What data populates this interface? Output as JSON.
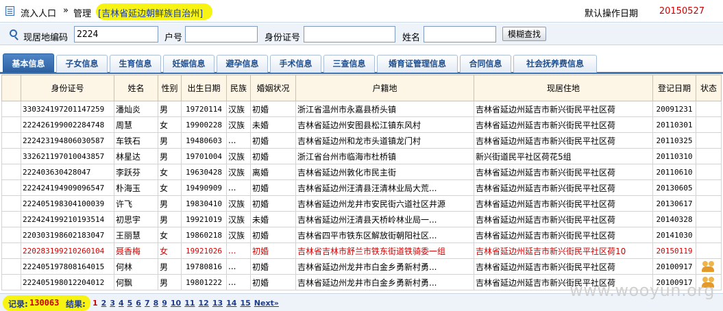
{
  "header": {
    "crumb_1": "流入人口",
    "separator": "»",
    "crumb_2": "管理",
    "region": "[吉林省延边朝鲜族自治州]",
    "default_date_label": "默认操作日期",
    "default_date": "20150527"
  },
  "search": {
    "residence_code_label": "现居地编码",
    "residence_code_value": "2224",
    "household_label": "户号",
    "household_value": "",
    "id_label": "身份证号",
    "id_value": "",
    "name_label": "姓名",
    "name_value": "",
    "fuzzy_button": "模糊查找"
  },
  "tabs": [
    {
      "label": "基本信息",
      "active": true
    },
    {
      "label": "子女信息"
    },
    {
      "label": "生育信息"
    },
    {
      "label": "妊娠信息"
    },
    {
      "label": "避孕信息"
    },
    {
      "label": "手术信息"
    },
    {
      "label": "三查信息"
    },
    {
      "label": "婚育证管理信息"
    },
    {
      "label": "合同信息"
    },
    {
      "label": "社会抚养费信息"
    }
  ],
  "table": {
    "headers": [
      "",
      "身份证号",
      "姓名",
      "性别",
      "出生日期",
      "民族",
      "婚姻状况",
      "户籍地",
      "现居住地",
      "登记日期",
      "状态"
    ],
    "rows": [
      [
        "330324197201147259",
        "潘灿炎",
        "男",
        "19720114",
        "汉族",
        "初婚",
        "浙江省温州市永嘉县桥头镇",
        "吉林省延边州延吉市新兴街民平社区荷",
        "20091231",
        ""
      ],
      [
        "222426199002284748",
        "周慧",
        "女",
        "19900228",
        "汉族",
        "未婚",
        "吉林省延边州安图县松江镇东风村",
        "吉林省延边州延吉市新兴街民平社区荷",
        "20110301",
        ""
      ],
      [
        "222423194806030587",
        "车铁石",
        "男",
        "19480603",
        "...",
        "初婚",
        "吉林省延边州和龙市头道镇龙门村",
        "吉林省延边州延吉市新兴街民平社区荷",
        "20110325",
        ""
      ],
      [
        "332621197010043857",
        "林星达",
        "男",
        "19701004",
        "汉族",
        "初婚",
        "浙江省台州市临海市杜桥镇",
        "新兴街道民平社区荷花5组",
        "20110310",
        ""
      ],
      [
        "222403630428047",
        "李跃芬",
        "女",
        "19630428",
        "汉族",
        "离婚",
        "吉林省延边州敦化市民主街",
        "吉林省延边州延吉市新兴街民平社区荷",
        "20110610",
        ""
      ],
      [
        "222424194909096547",
        "朴海玉",
        "女",
        "19490909",
        "...",
        "初婚",
        "吉林省延边州汪清县汪清林业局大荒...",
        "吉林省延边州延吉市新兴街民平社区荷",
        "20130605",
        ""
      ],
      [
        "222405198304100039",
        "许飞",
        "男",
        "19830410",
        "汉族",
        "初婚",
        "吉林省延边州龙井市安民街六道社区井源",
        "吉林省延边州延吉市新兴街民平社区荷",
        "20130617",
        ""
      ],
      [
        "222424199210193514",
        "初思宇",
        "男",
        "19921019",
        "汉族",
        "未婚",
        "吉林省延边州汪清县天桥岭林业局一...",
        "吉林省延边州延吉市新兴街民平社区荷",
        "20140328",
        ""
      ],
      [
        "220303198602183047",
        "王丽慧",
        "女",
        "19860218",
        "汉族",
        "初婚",
        "吉林省四平市铁东区解放街朝阳社区...",
        "吉林省延边州延吉市新兴街民平社区荷",
        "20141030",
        ""
      ],
      [
        "220283199210260104",
        "聂香梅",
        "女",
        "19921026",
        "...",
        "初婚",
        "吉林省吉林市舒兰市铁东街道铁骑委一组",
        "吉林省延边州延吉市新兴街民平社区荷10",
        "20150119",
        ""
      ],
      [
        "222405197808164015",
        "何林",
        "男",
        "19780816",
        "...",
        "初婚",
        "吉林省延边州龙井市白金乡勇新村勇...",
        "吉林省延边州延吉市新兴街民平社区荷",
        "20100917",
        "icon"
      ],
      [
        "222405198012204012",
        "何飘",
        "男",
        "19801222",
        "...",
        "初婚",
        "吉林省延边州龙井市白金乡勇新村勇...",
        "吉林省延边州延吉市新兴街民平社区荷",
        "20100917",
        "icon"
      ]
    ],
    "highlight_row_index": 9
  },
  "footer": {
    "records_label": "记录:",
    "records_count": "130063",
    "results_label": "结果:",
    "pages": [
      "1",
      "2",
      "3",
      "4",
      "5",
      "6",
      "7",
      "8",
      "9",
      "10",
      "11",
      "12",
      "13",
      "14",
      "15"
    ],
    "current_page": "1",
    "next_label": "Next»"
  },
  "watermark": "www.wooyun.org",
  "colors": {
    "accent": "#3f74b5",
    "highlight_yellow": "#f7f313",
    "alert_red": "#d40000"
  }
}
